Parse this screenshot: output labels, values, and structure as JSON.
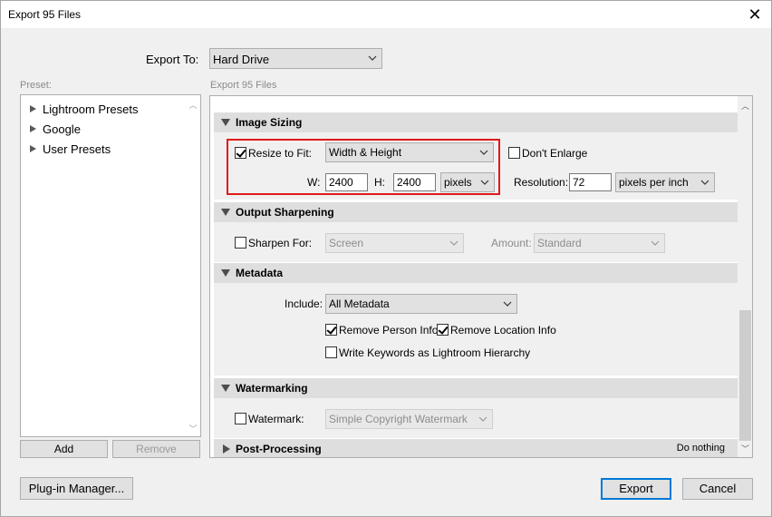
{
  "window": {
    "title": "Export 95 Files"
  },
  "export_to": {
    "label": "Export To:",
    "value": "Hard Drive"
  },
  "section_title": "Export 95 Files",
  "preset": {
    "label": "Preset:",
    "items": [
      "Lightroom Presets",
      "Google",
      "User Presets"
    ],
    "add_label": "Add",
    "remove_label": "Remove"
  },
  "image_sizing": {
    "title": "Image Sizing",
    "resize_label": "Resize to Fit:",
    "resize_checked": true,
    "resize_mode": "Width & Height",
    "dont_enlarge_label": "Don't Enlarge",
    "w_label": "W:",
    "w_value": "2400",
    "h_label": "H:",
    "h_value": "2400",
    "unit": "pixels",
    "resolution_label": "Resolution:",
    "resolution_value": "72",
    "resolution_unit": "pixels per inch"
  },
  "output_sharpening": {
    "title": "Output Sharpening",
    "sharpen_label": "Sharpen For:",
    "sharpen_value": "Screen",
    "amount_label": "Amount:",
    "amount_value": "Standard"
  },
  "metadata": {
    "title": "Metadata",
    "include_label": "Include:",
    "include_value": "All Metadata",
    "remove_person_label": "Remove Person Info",
    "remove_location_label": "Remove Location Info",
    "keywords_label": "Write Keywords as Lightroom Hierarchy"
  },
  "watermarking": {
    "title": "Watermarking",
    "watermark_label": "Watermark:",
    "watermark_value": "Simple Copyright Watermark"
  },
  "post_processing": {
    "title": "Post-Processing",
    "status": "Do nothing"
  },
  "footer": {
    "plugin_manager_label": "Plug-in Manager...",
    "export_label": "Export",
    "cancel_label": "Cancel"
  },
  "colors": {
    "accent": "#0078d7",
    "highlight": "#e01a1a"
  }
}
